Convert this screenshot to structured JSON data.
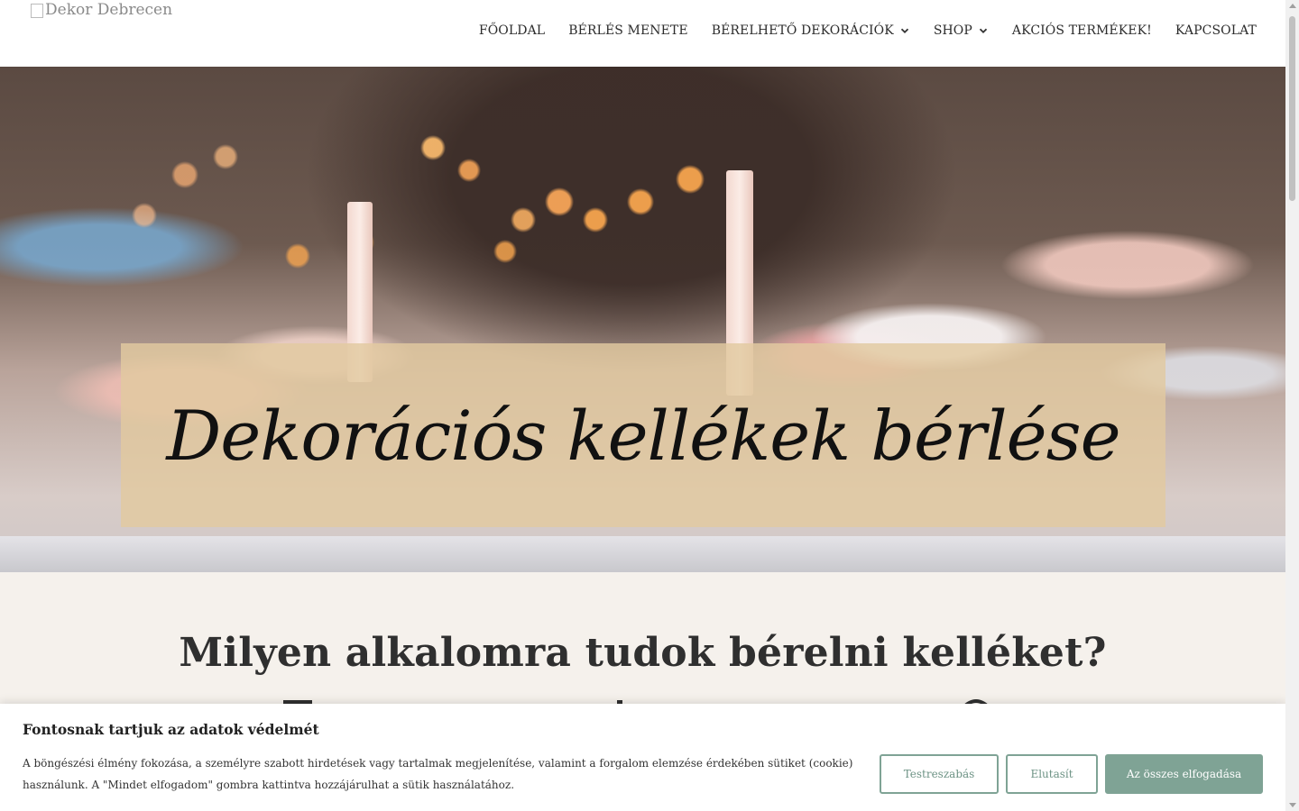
{
  "header": {
    "logo_alt": "Dekor Debrecen",
    "nav": [
      {
        "label": "FŐOLDAL",
        "has_dropdown": false
      },
      {
        "label": "BÉRLÉS MENETE",
        "has_dropdown": false
      },
      {
        "label": "BÉRELHETŐ DEKORÁCIÓK",
        "has_dropdown": true
      },
      {
        "label": "SHOP",
        "has_dropdown": true
      },
      {
        "label": "AKCIÓS TERMÉKEK!",
        "has_dropdown": false
      },
      {
        "label": "KAPCSOLAT",
        "has_dropdown": false
      }
    ]
  },
  "hero": {
    "title": "Dekorációs kellékek bérlése"
  },
  "section": {
    "heading": "Milyen alkalomra tudok bérelni kelléket?"
  },
  "cookie": {
    "title": "Fontosnak tartjuk az adatok védelmét",
    "text": "A böngészési élmény fokozása, a személyre szabott hirdetések vagy tartalmak megjelenítése, valamint a forgalom elemzése érdekében sütiket (cookie) használunk. A \"Mindet elfogadom\" gombra kattintva hozzájárulhat a sütik használatához.",
    "customize_label": "Testreszabás",
    "reject_label": "Elutasít",
    "accept_label": "Az összes elfogadása"
  },
  "colors": {
    "accent": "#7fa395",
    "section_bg": "#f5f1ec",
    "hero_band": "#e2c9a0"
  }
}
